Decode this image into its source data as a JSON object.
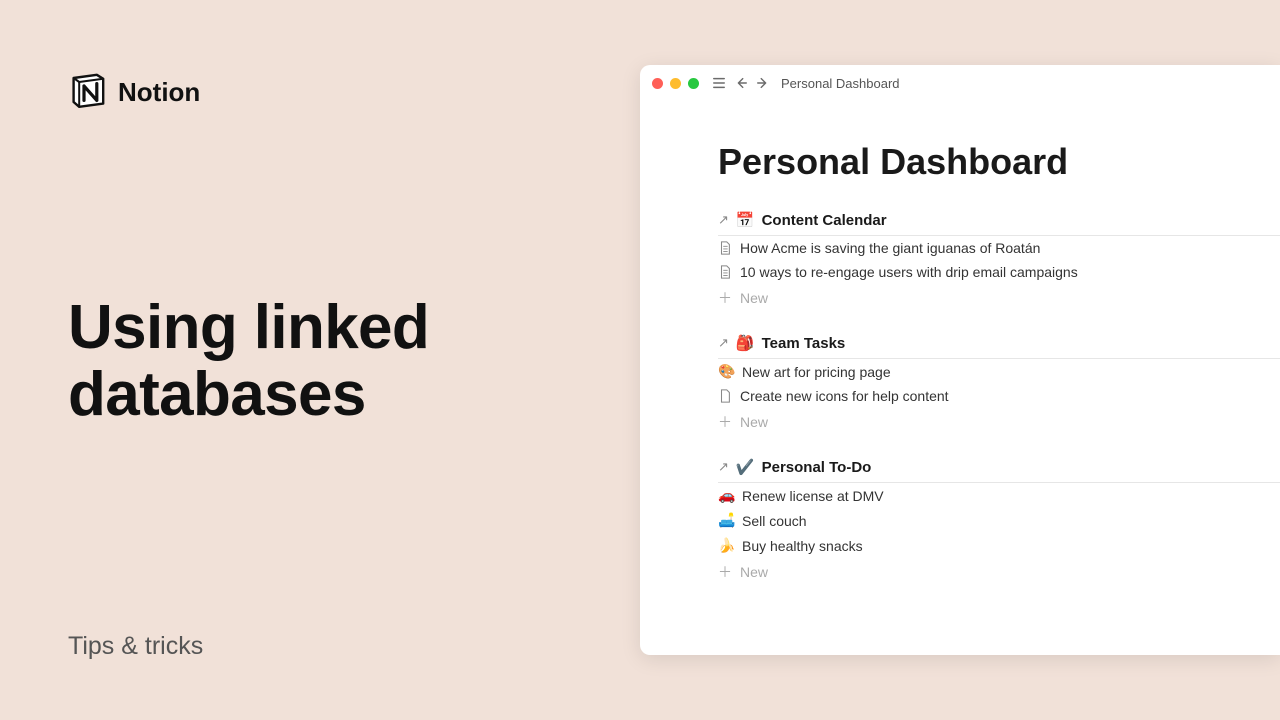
{
  "brand": {
    "name": "Notion"
  },
  "promo": {
    "title_line1": "Using linked",
    "title_line2": "databases",
    "subtitle": "Tips & tricks"
  },
  "window": {
    "breadcrumb": "Personal Dashboard",
    "page_title": "Personal Dashboard",
    "new_label": "New",
    "sections": [
      {
        "emoji": "📅",
        "title": "Content Calendar",
        "items": [
          {
            "icon": "page",
            "text": "How Acme is saving the giant iguanas of Roatán"
          },
          {
            "icon": "page",
            "text": "10 ways to re-engage users with drip email campaigns"
          }
        ]
      },
      {
        "emoji": "🎒",
        "title": "Team Tasks",
        "items": [
          {
            "emoji": "🎨",
            "text": "New art for pricing page"
          },
          {
            "icon": "page-blank",
            "text": "Create new icons for help content"
          }
        ]
      },
      {
        "emoji": "✔️",
        "title": "Personal To-Do",
        "items": [
          {
            "emoji": "🚗",
            "text": "Renew license at DMV"
          },
          {
            "emoji": "🛋️",
            "text": "Sell couch"
          },
          {
            "emoji": "🍌",
            "text": "Buy healthy snacks"
          }
        ]
      }
    ]
  }
}
